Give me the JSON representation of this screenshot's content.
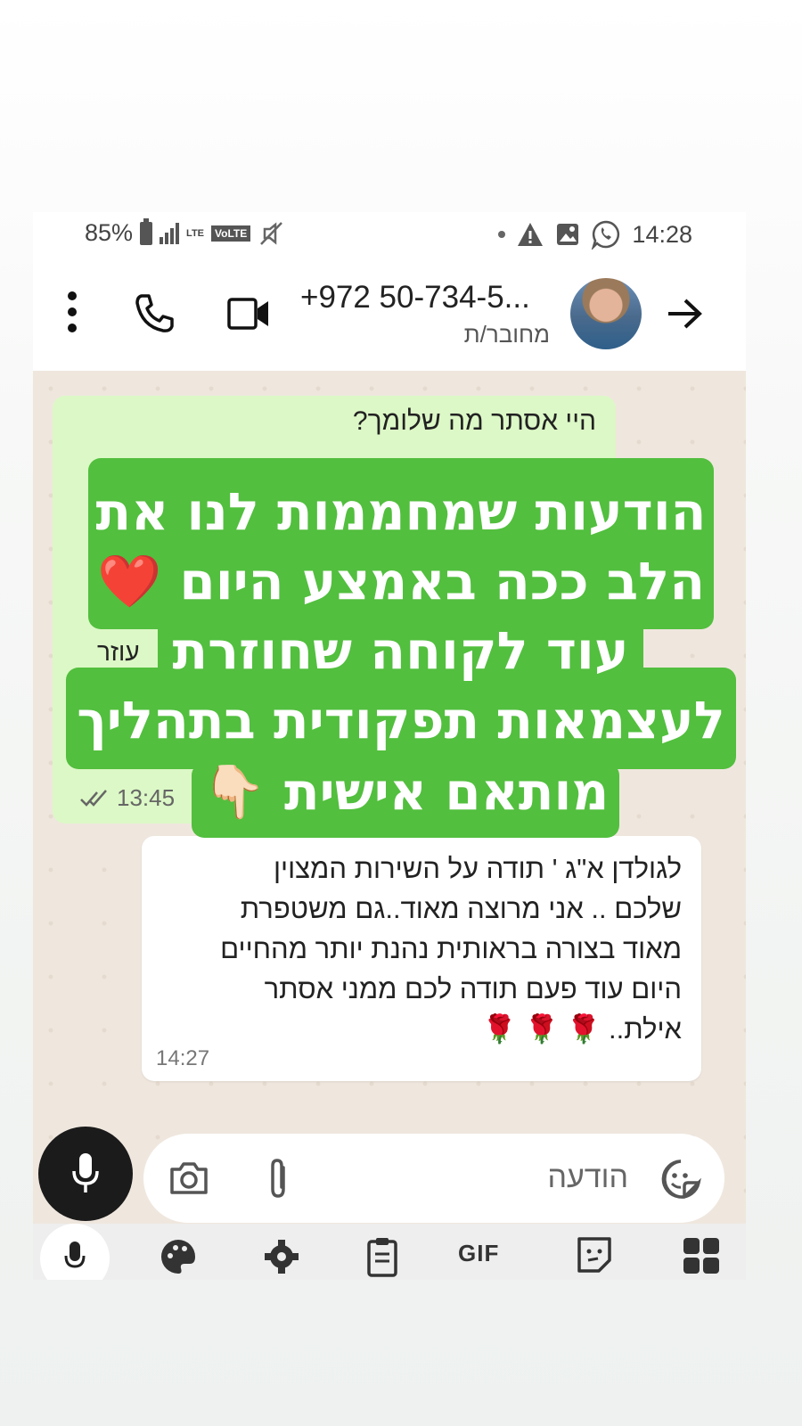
{
  "status_bar": {
    "battery": "85%",
    "network": "LTE",
    "volte": "VoLTE",
    "time": "14:28"
  },
  "header": {
    "contact_name": "+972 50-734-5...",
    "contact_status": "מחובר/ת"
  },
  "messages": {
    "outgoing": {
      "text": "היי אסתר מה שלומך?",
      "partial_text": "עוזר",
      "time": "13:45"
    },
    "incoming": {
      "lines": [
        "לגולדן א\"ג ' תודה  על השירות המצוין",
        "שלכם .. אני מרוצה מאוד..גם משטפרת",
        "מאוד בצורה בראותית נהנת יותר מהחיים",
        "היום  עוד פעם תודה לכם ממני אסתר",
        "אילת.. 🌹 🌹 🌹"
      ],
      "time": "14:27"
    }
  },
  "input": {
    "placeholder": "הודעה"
  },
  "keyboard": {
    "gif_label": "GIF"
  },
  "overlay": {
    "lines": [
      "הודעות שמחממות לנו את",
      "הלב ככה באמצע היום ❤️",
      "עוד לקוחה שחוזרת",
      "לעצמאות תפקודית בתהליך",
      "מותאם אישית 👇🏻"
    ],
    "color": "#52bf3e"
  }
}
